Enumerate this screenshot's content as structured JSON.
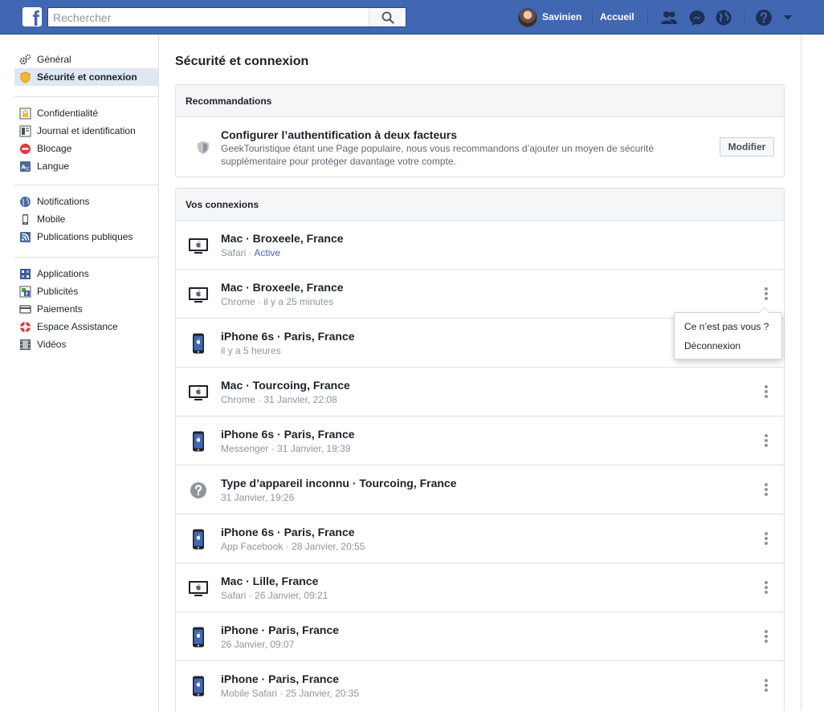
{
  "topbar": {
    "logo": "f",
    "search_placeholder": "Rechercher",
    "user_name": "Savinien",
    "home_label": "Accueil",
    "brand_color": "#4267b2"
  },
  "sidebar": {
    "group1": [
      {
        "label": "Général",
        "icon": "gear-icon"
      },
      {
        "label": "Sécurité et connexion",
        "icon": "shield-badge-icon",
        "active": true
      }
    ],
    "group2": [
      {
        "label": "Confidentialité",
        "icon": "lock-icon"
      },
      {
        "label": "Journal et identification",
        "icon": "timeline-icon"
      },
      {
        "label": "Blocage",
        "icon": "block-icon"
      },
      {
        "label": "Langue",
        "icon": "language-icon"
      }
    ],
    "group3": [
      {
        "label": "Notifications",
        "icon": "globe-icon"
      },
      {
        "label": "Mobile",
        "icon": "mobile-icon"
      },
      {
        "label": "Publications publiques",
        "icon": "rss-icon"
      }
    ],
    "group4": [
      {
        "label": "Applications",
        "icon": "apps-icon"
      },
      {
        "label": "Publicités",
        "icon": "ads-icon"
      },
      {
        "label": "Paiements",
        "icon": "payments-icon"
      },
      {
        "label": "Espace Assistance",
        "icon": "lifebuoy-icon"
      },
      {
        "label": "Vidéos",
        "icon": "film-icon"
      }
    ]
  },
  "main": {
    "title": "Sécurité et connexion",
    "recommendations": {
      "header": "Recommandations",
      "title": "Configurer l’authentification à deux facteurs",
      "description": "GeekTouristique étant une Page populaire, nous vous recommandons d’ajouter un moyen de sécurité supplémentaire pour protéger davantage votre compte.",
      "button": "Modifier"
    },
    "connections": {
      "header": "Vos connexions",
      "items": [
        {
          "device": "desktop",
          "title": "Mac · Broxeele, France",
          "app": "Safari",
          "time": "",
          "status": "Active"
        },
        {
          "device": "desktop",
          "title": "Mac · Broxeele, France",
          "app": "Chrome",
          "time": "il y a 25 minutes"
        },
        {
          "device": "phone",
          "title": "iPhone 6s · Paris, France",
          "app": "",
          "time": "il y a 5 heures"
        },
        {
          "device": "desktop",
          "title": "Mac · Tourcoing, France",
          "app": "Chrome",
          "time": "31 Janvier, 22:08"
        },
        {
          "device": "phone",
          "title": "iPhone 6s · Paris, France",
          "app": "Messenger",
          "time": "31 Janvier, 19:39"
        },
        {
          "device": "unknown",
          "title": "Type d’appareil inconnu · Tourcoing, France",
          "app": "",
          "time": "31 Janvier, 19:26"
        },
        {
          "device": "phone",
          "title": "iPhone 6s · Paris, France",
          "app": "App Facebook",
          "time": "28 Janvier, 20:55"
        },
        {
          "device": "desktop",
          "title": "Mac · Lille, France",
          "app": "Safari",
          "time": "26 Janvier, 09:21"
        },
        {
          "device": "phone",
          "title": "iPhone · Paris, France",
          "app": "",
          "time": "26 Janvier, 09:07"
        },
        {
          "device": "phone",
          "title": "iPhone · Paris, France",
          "app": "Mobile Safari",
          "time": "25 Janvier, 20:35"
        }
      ]
    },
    "popover": {
      "item1": "Ce n’est pas vous ?",
      "item2": "Déconnexion"
    }
  }
}
